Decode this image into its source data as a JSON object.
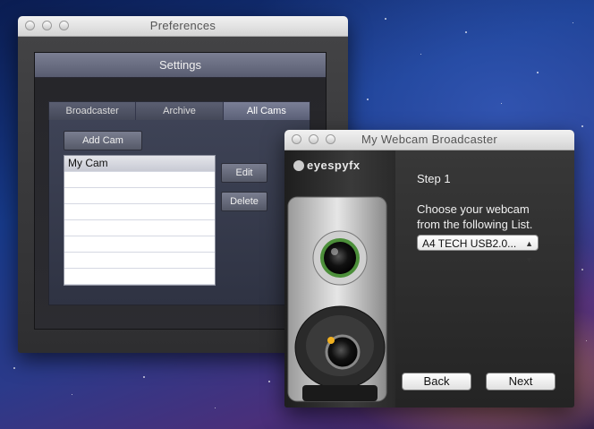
{
  "preferences": {
    "title": "Preferences",
    "settings_title": "Settings",
    "tabs": [
      {
        "label": "Broadcaster"
      },
      {
        "label": "Archive"
      },
      {
        "label": "All Cams"
      }
    ],
    "active_tab": "All Cams",
    "add_cam_label": "Add Cam",
    "edit_label": "Edit",
    "delete_label": "Delete",
    "cams": [
      "My Cam"
    ]
  },
  "broadcaster": {
    "title": "My Webcam Broadcaster",
    "logo_text": "eyespyfx",
    "step_label": "Step 1",
    "instruction_line1": "Choose your webcam",
    "instruction_line2": "from the following List.",
    "selected_webcam": "A4 TECH USB2.0...",
    "back_label": "Back",
    "next_label": "Next"
  }
}
